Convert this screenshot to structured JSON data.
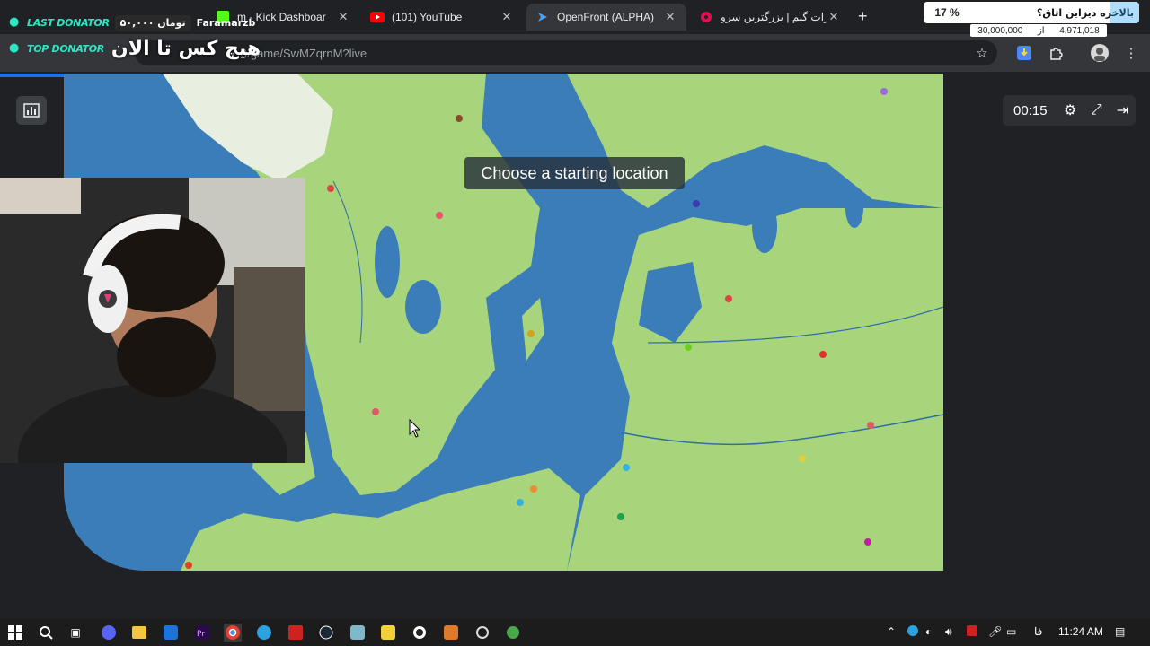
{
  "tabs": [
    {
      "title": "m - Kick Dashboar"
    },
    {
      "title": "(101) YouTube"
    },
    {
      "title": "OpenFront (ALPHA)"
    },
    {
      "title": "آپارات گیم | بزرگترین سرو"
    }
  ],
  "new_tab": "+",
  "url": "9/game/SwMZqrnM?live",
  "overlay": {
    "last_donator_label": "LAST DONATOR",
    "last_donator_amount": "۵۰,۰۰۰ تومان",
    "last_donator_name": "Faramarzb",
    "top_donator_label": "TOP DONATOR",
    "top_donator_text": "هیچ کس تا الان",
    "goal_title": "بالاخره دیزاین اتاق؟",
    "goal_percent": "17 %",
    "goal_fraction": 0.17,
    "goal_current": "4,971,018",
    "goal_of": "از",
    "goal_target": "30,000,000"
  },
  "game": {
    "message": "Choose a starting location",
    "timer": "00:15"
  },
  "taskbar": {
    "lang": "فا",
    "time": "11:24 AM"
  },
  "colors": {
    "sea": "#3a7db8",
    "land": "#a8d47c",
    "accent": "#1a73e8"
  },
  "icons": [
    "stats-icon",
    "settings-icon",
    "fullscreen-icon",
    "exit-icon",
    "star-icon",
    "download-icon",
    "extensions-icon",
    "profile-icon",
    "menu-icon"
  ]
}
